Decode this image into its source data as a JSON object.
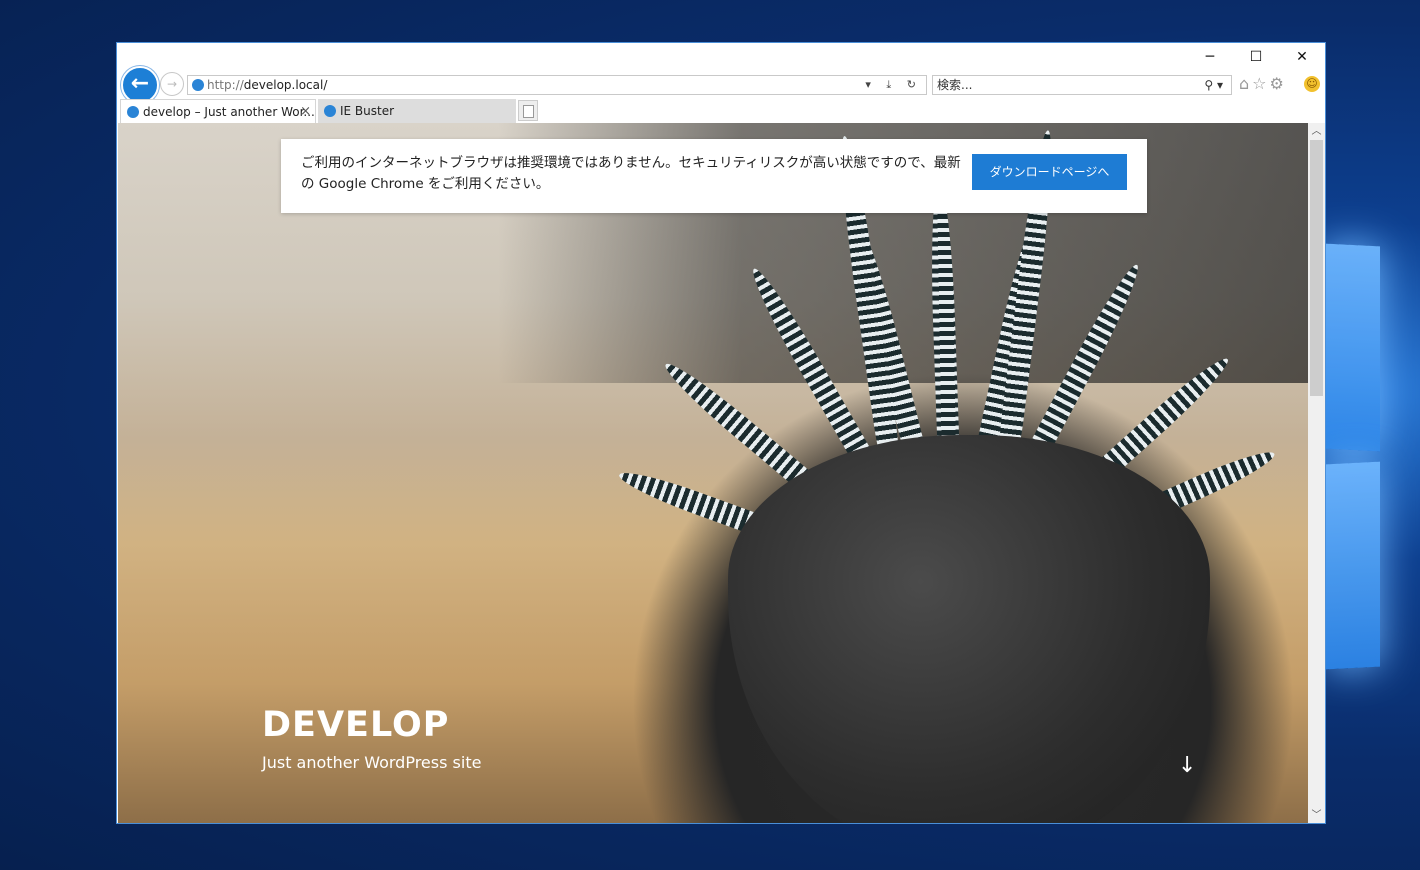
{
  "window": {
    "minimize_label": "─",
    "maximize_label": "☐",
    "close_label": "✕"
  },
  "nav": {
    "back_label": "←",
    "forward_label": "→",
    "address_protocol": "http://",
    "address_host": "develop.local/",
    "address_tools": "▾ ⤓ ↻",
    "search_placeholder": "検索...",
    "search_icon": "⚲ ▾",
    "tools_icons": "⌂☆⚙",
    "smiley": "☺"
  },
  "tabs": [
    {
      "label": "develop – Just another Wor...",
      "close": "×",
      "active": true
    },
    {
      "label": "IE Buster",
      "active": false
    }
  ],
  "notice": {
    "message": "ご利用のインターネットブラウザは推奨環境ではありません。セキュリティリスクが高い状態ですので、最新の Google Chrome をご利用ください。",
    "button_label": "ダウンロードページへ"
  },
  "site": {
    "title": "DEVELOP",
    "description": "Just another WordPress site",
    "scroll_arrow": "↓"
  },
  "scrollbar": {
    "up": "︿",
    "down": "﹀"
  },
  "colors": {
    "accent": "#1e7cd4",
    "window_border": "#4a8fd8"
  }
}
